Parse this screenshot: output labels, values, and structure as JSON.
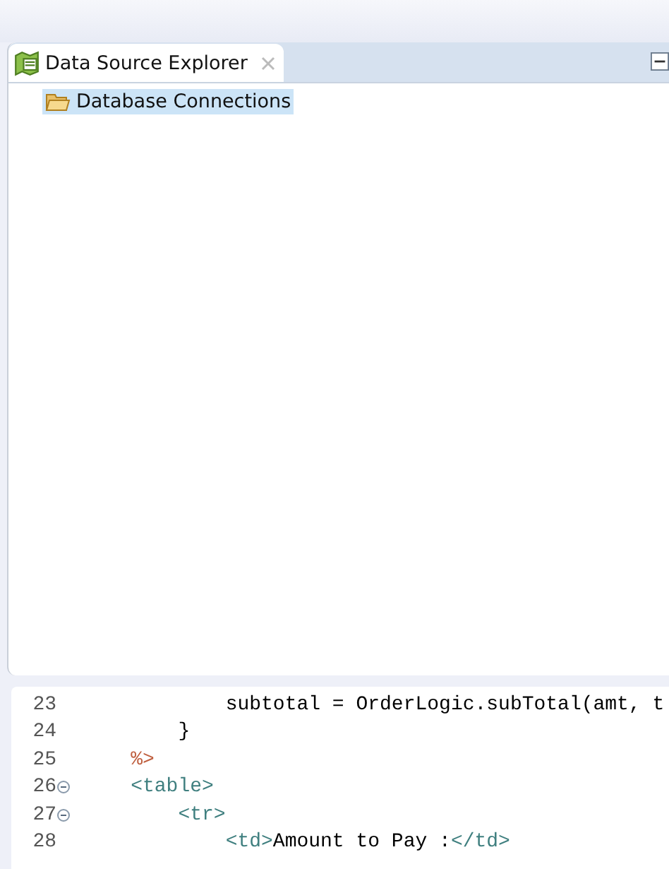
{
  "view_tab": {
    "title": "Data Source Explorer",
    "selected": true
  },
  "tree": [
    {
      "label": "Database Connections",
      "selected": true
    }
  ],
  "editor": {
    "lines": [
      {
        "number": "23",
        "fold": false,
        "tokens": [
          {
            "kind": "text",
            "text": "            subtotal = OrderLogic.subTotal(amt, t"
          }
        ]
      },
      {
        "number": "24",
        "fold": false,
        "tokens": [
          {
            "kind": "text",
            "text": "        }"
          }
        ]
      },
      {
        "number": "25",
        "fold": false,
        "tokens": [
          {
            "kind": "jsp",
            "text": "    %>"
          }
        ]
      },
      {
        "number": "26",
        "fold": true,
        "tokens": [
          {
            "kind": "tag",
            "text": "    <table>"
          }
        ]
      },
      {
        "number": "27",
        "fold": true,
        "tokens": [
          {
            "kind": "tag",
            "text": "        <tr>"
          }
        ]
      },
      {
        "number": "28",
        "fold": false,
        "tokens": [
          {
            "kind": "tag",
            "text": "            <td>"
          },
          {
            "kind": "text",
            "text": "Amount to Pay :"
          },
          {
            "kind": "tag",
            "text": "</td>"
          }
        ]
      }
    ]
  }
}
